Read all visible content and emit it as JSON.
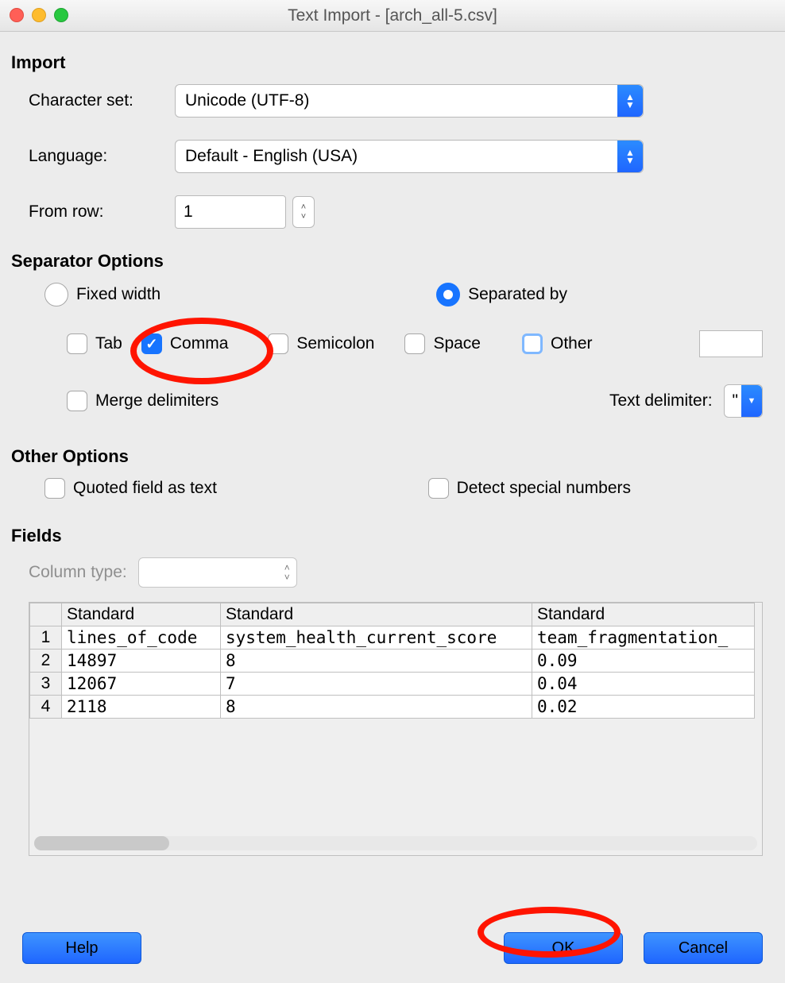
{
  "window": {
    "title": "Text Import - [arch_all-5.csv]"
  },
  "import": {
    "heading": "Import",
    "charset_label": "Character set:",
    "charset_value": "Unicode (UTF-8)",
    "language_label": "Language:",
    "language_value": "Default - English (USA)",
    "from_row_label": "From row:",
    "from_row_value": "1"
  },
  "separator": {
    "heading": "Separator Options",
    "fixed_label": "Fixed width",
    "separated_label": "Separated by",
    "mode": "separated",
    "tab_label": "Tab",
    "tab_checked": false,
    "comma_label": "Comma",
    "comma_checked": true,
    "semicolon_label": "Semicolon",
    "semicolon_checked": false,
    "space_label": "Space",
    "space_checked": false,
    "other_label": "Other",
    "other_checked": false,
    "other_value": "",
    "merge_label": "Merge delimiters",
    "merge_checked": false,
    "text_delim_label": "Text delimiter:",
    "text_delim_value": "\""
  },
  "other": {
    "heading": "Other Options",
    "quoted_label": "Quoted field as text",
    "quoted_checked": false,
    "detect_label": "Detect special numbers",
    "detect_checked": false
  },
  "fields": {
    "heading": "Fields",
    "column_type_label": "Column type:",
    "column_type_value": "",
    "col_types": [
      "Standard",
      "Standard",
      "Standard"
    ],
    "rows": [
      [
        "1",
        "lines_of_code",
        "system_health_current_score",
        "team_fragmentation_"
      ],
      [
        "2",
        "14897",
        "8",
        "0.09"
      ],
      [
        "3",
        "12067",
        "7",
        "0.04"
      ],
      [
        "4",
        "2118",
        "8",
        "0.02"
      ]
    ]
  },
  "buttons": {
    "help": "Help",
    "ok": "OK",
    "cancel": "Cancel"
  }
}
